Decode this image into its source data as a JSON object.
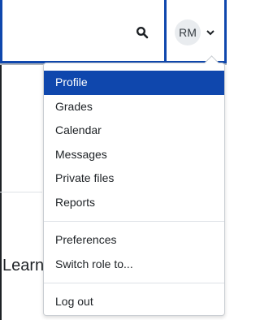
{
  "user_menu": {
    "initials": "RM",
    "items": [
      {
        "label": "Profile",
        "active": true
      },
      {
        "label": "Grades"
      },
      {
        "label": "Calendar"
      },
      {
        "label": "Messages"
      },
      {
        "label": "Private files"
      },
      {
        "label": "Reports"
      },
      {
        "label": "Preferences"
      },
      {
        "label": "Switch role to..."
      },
      {
        "label": "Log out"
      }
    ]
  },
  "page": {
    "visible_text": "Learn"
  },
  "icons": {
    "search": "search-icon",
    "caret": "chevron-down-icon"
  },
  "colors": {
    "accent": "#0f47ad",
    "text": "#1d2125",
    "avatar_bg": "#e9ecef"
  }
}
